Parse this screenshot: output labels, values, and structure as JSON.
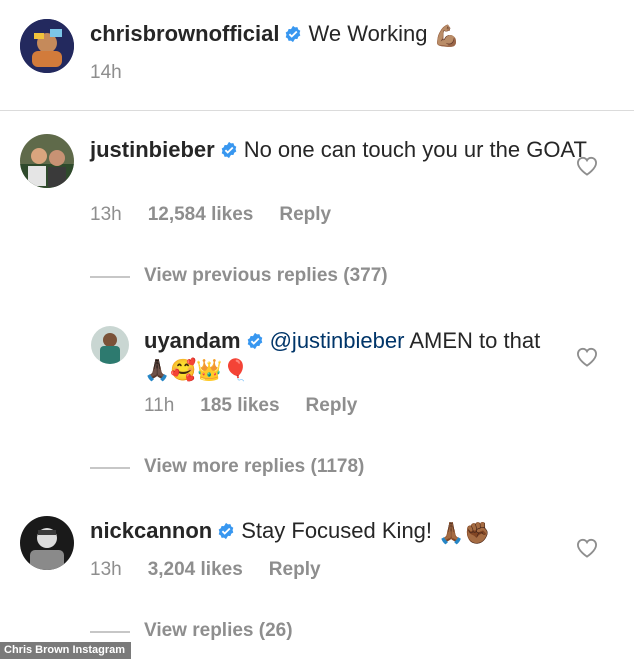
{
  "post": {
    "username": "chrisbrownofficial",
    "caption": "We Working",
    "caption_emoji": "💪🏽",
    "time": "14h"
  },
  "comments": [
    {
      "username": "justinbieber",
      "text": "No one can touch you ur the GOAT",
      "time": "13h",
      "likes": "12,584 likes",
      "reply": "Reply",
      "view_replies": "View previous replies (377)"
    },
    {
      "username": "uyandam",
      "mention": "@justinbieber",
      "text": "AMEN to that",
      "emoji": "🙏🏿🥰👑🎈",
      "time": "11h",
      "likes": "185 likes",
      "reply": "Reply",
      "view_replies": "View more replies (1178)"
    },
    {
      "username": "nickcannon",
      "text": "Stay Focused King!",
      "emoji": "🙏🏾✊🏾",
      "time": "13h",
      "likes": "3,204 likes",
      "reply": "Reply",
      "view_replies": "View replies (26)"
    }
  ],
  "credit": "Chris Brown Instagram",
  "colors": {
    "verified": "#3897f0",
    "meta": "#8e8e8e",
    "text": "#262626"
  },
  "icons": [
    "verified-badge-icon",
    "heart-icon"
  ]
}
